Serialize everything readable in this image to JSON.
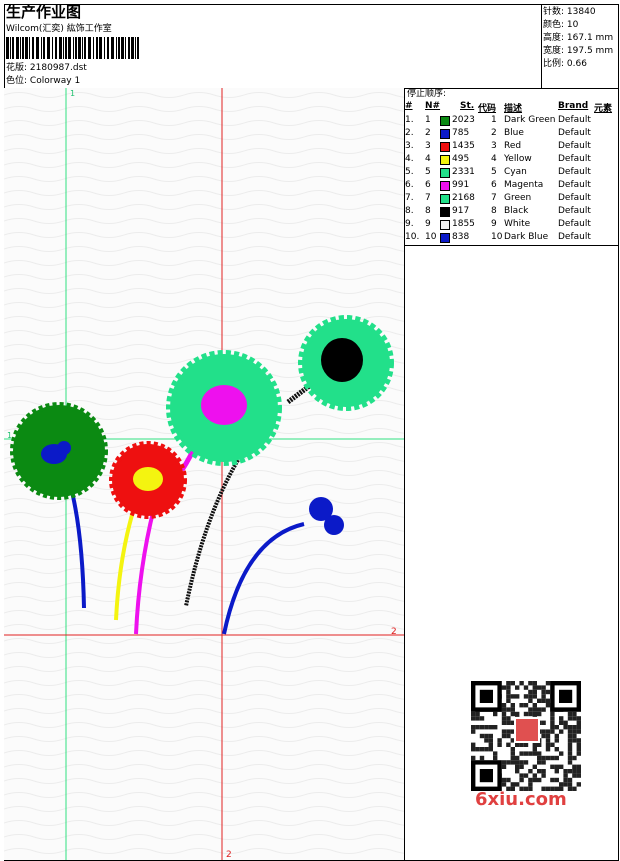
{
  "header": {
    "title": "生产作业图",
    "subtitle": "Wilcom(汇奕) 紘饰工作室",
    "design_label": "花版:",
    "design_value": "2180987.dst",
    "colorway_label": "色位:",
    "colorway_value": "Colorway 1"
  },
  "stats": [
    {
      "label": "针数:",
      "value": "13840"
    },
    {
      "label": "颜色:",
      "value": "10"
    },
    {
      "label": "高度:",
      "value": "167.1 mm"
    },
    {
      "label": "宽度:",
      "value": "197.5 mm"
    },
    {
      "label": "比例:",
      "value": "0.66"
    }
  ],
  "canvas_markers": {
    "top": "1",
    "left": "1",
    "right": "2",
    "bottom": "2"
  },
  "sequence": {
    "title": "停止顺序:",
    "headers": {
      "num": "#",
      "n": "N#",
      "stitches": "St.",
      "code": "代码",
      "desc": "描述",
      "brand": "Brand",
      "element": "元素"
    },
    "rows": [
      {
        "num": "1.",
        "n": "1",
        "color": "#0b8a12",
        "stitches": "2023",
        "code": "1",
        "desc": "Dark Green",
        "brand": "Default"
      },
      {
        "num": "2.",
        "n": "2",
        "color": "#0b1ac8",
        "stitches": "785",
        "code": "2",
        "desc": "Blue",
        "brand": "Default"
      },
      {
        "num": "3.",
        "n": "3",
        "color": "#ee1010",
        "stitches": "1435",
        "code": "3",
        "desc": "Red",
        "brand": "Default"
      },
      {
        "num": "4.",
        "n": "4",
        "color": "#f4f410",
        "stitches": "495",
        "code": "4",
        "desc": "Yellow",
        "brand": "Default"
      },
      {
        "num": "5.",
        "n": "5",
        "color": "#22e08a",
        "stitches": "2331",
        "code": "5",
        "desc": "Cyan",
        "brand": "Default"
      },
      {
        "num": "6.",
        "n": "6",
        "color": "#ee10ee",
        "stitches": "991",
        "code": "6",
        "desc": "Magenta",
        "brand": "Default"
      },
      {
        "num": "7.",
        "n": "7",
        "color": "#22e08a",
        "stitches": "2168",
        "code": "7",
        "desc": "Green",
        "brand": "Default"
      },
      {
        "num": "8.",
        "n": "8",
        "color": "#000000",
        "stitches": "917",
        "code": "8",
        "desc": "Black",
        "brand": "Default"
      },
      {
        "num": "9.",
        "n": "9",
        "color": "#f0f0f0",
        "stitches": "1855",
        "code": "9",
        "desc": "White",
        "brand": "Default"
      },
      {
        "num": "10.",
        "n": "10",
        "color": "#0b1ac8",
        "stitches": "838",
        "code": "10",
        "desc": "Dark Blue",
        "brand": "Default"
      }
    ]
  },
  "watermark": "6xiu.com"
}
